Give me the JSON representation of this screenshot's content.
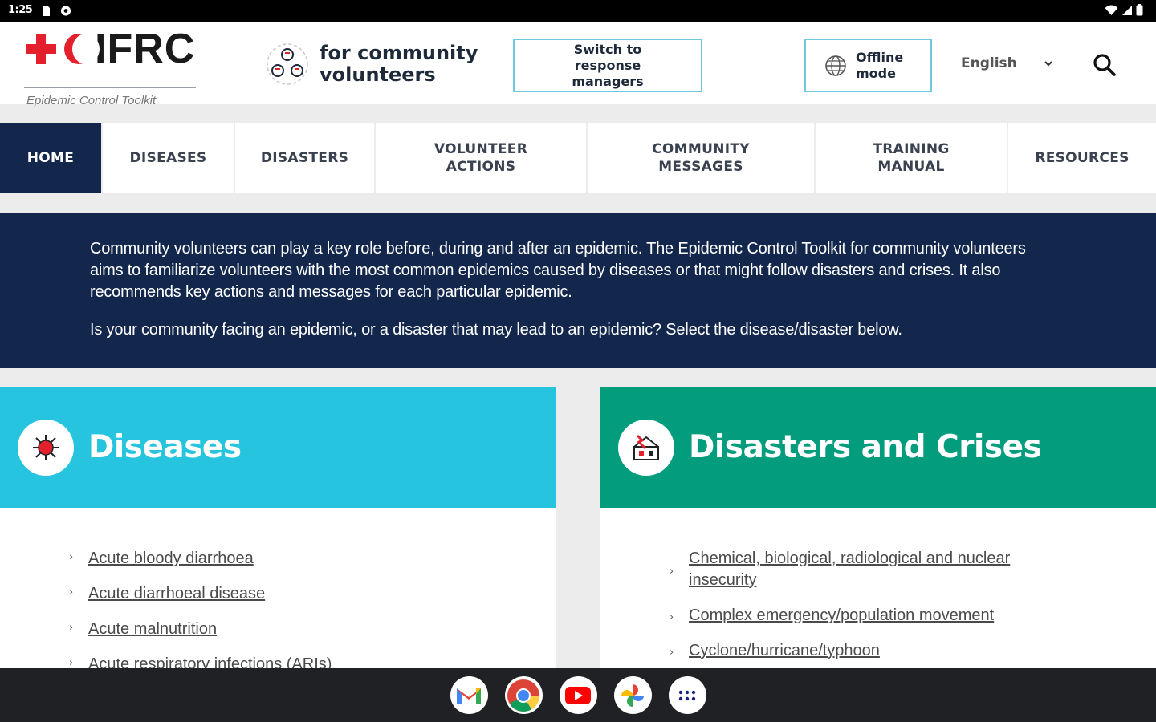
{
  "status_bar": {
    "time": "1:25"
  },
  "header": {
    "logo_text": "IFRC",
    "logo_subtitle": "Epidemic Control Toolkit",
    "audience_line1": "for community",
    "audience_line2": "volunteers",
    "switch_button": "Switch to response managers",
    "offline_button": "Offline mode",
    "language": "English"
  },
  "nav": {
    "items": [
      {
        "label": "HOME",
        "active": true
      },
      {
        "label": "DISEASES"
      },
      {
        "label": "DISASTERS"
      },
      {
        "label": "VOLUNTEER ACTIONS"
      },
      {
        "label": "COMMUNITY MESSAGES"
      },
      {
        "label": "TRAINING MANUAL"
      },
      {
        "label": "RESOURCES"
      }
    ]
  },
  "intro": {
    "paragraph1": "Community volunteers can play a key role before, during and after an epidemic. The Epidemic Control Toolkit for community volunteers aims to familiarize volunteers with the most common epidemics caused by diseases or that might follow disasters and crises. It also recommends key actions and messages for each particular epidemic.",
    "paragraph2": "Is your community facing an epidemic, or a disaster that may lead to an epidemic? Select the disease/disaster below."
  },
  "diseases": {
    "title": "Diseases",
    "items": [
      "Acute bloody diarrhoea",
      "Acute diarrhoeal disease",
      "Acute malnutrition",
      "Acute respiratory infections (ARIs)"
    ]
  },
  "disasters": {
    "title": "Disasters and Crises",
    "items": [
      "Chemical, biological, radiological and nuclear insecurity",
      "Complex emergency/population movement",
      "Cyclone/hurricane/typhoon"
    ]
  },
  "colors": {
    "navy": "#13274d",
    "diseases_header": "#27c4df",
    "disasters_header": "#039c7d",
    "brand_red": "#e4202c"
  },
  "taskbar": {
    "apps": [
      "gmail-icon",
      "chrome-icon",
      "youtube-icon",
      "photos-icon",
      "app-launcher-icon"
    ]
  }
}
